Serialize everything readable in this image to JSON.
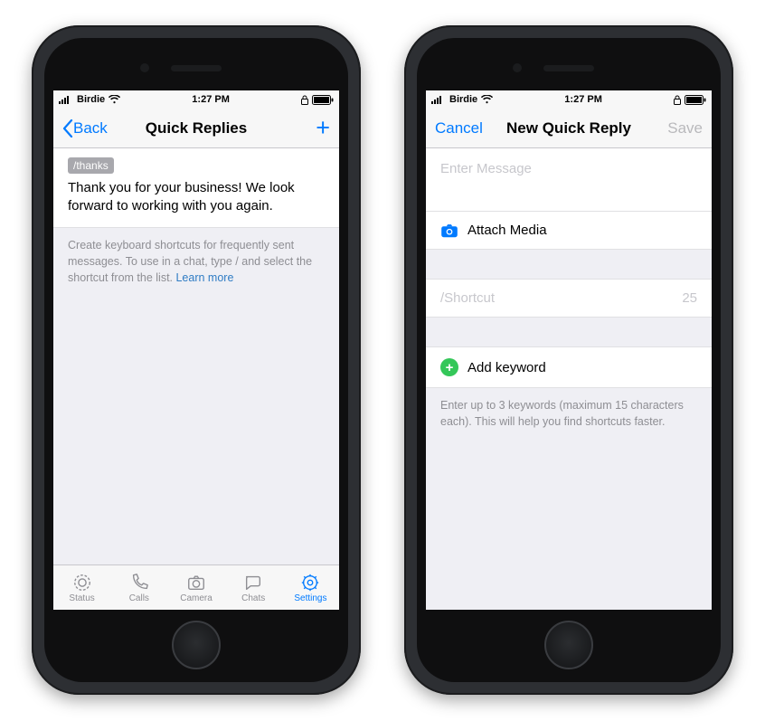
{
  "statusbar": {
    "carrier": "Birdie",
    "time": "1:27 PM"
  },
  "phone1": {
    "nav": {
      "back": "Back",
      "title": "Quick Replies"
    },
    "reply": {
      "shortcut": "/thanks",
      "body": "Thank you for your business! We look forward to working with you again."
    },
    "footer": {
      "text": "Create keyboard shortcuts for frequently sent messages. To use in a chat, type / and select the shortcut from the list. ",
      "link": "Learn more"
    },
    "tabs": {
      "status": "Status",
      "calls": "Calls",
      "camera": "Camera",
      "chats": "Chats",
      "settings": "Settings"
    }
  },
  "phone2": {
    "nav": {
      "cancel": "Cancel",
      "title": "New Quick Reply",
      "save": "Save"
    },
    "message_placeholder": "Enter Message",
    "attach": "Attach Media",
    "shortcut_placeholder": "/Shortcut",
    "shortcut_limit": "25",
    "keyword": "Add keyword",
    "keyword_footer": "Enter up to 3 keywords (maximum 15 characters each). This will help you find shortcuts faster."
  }
}
